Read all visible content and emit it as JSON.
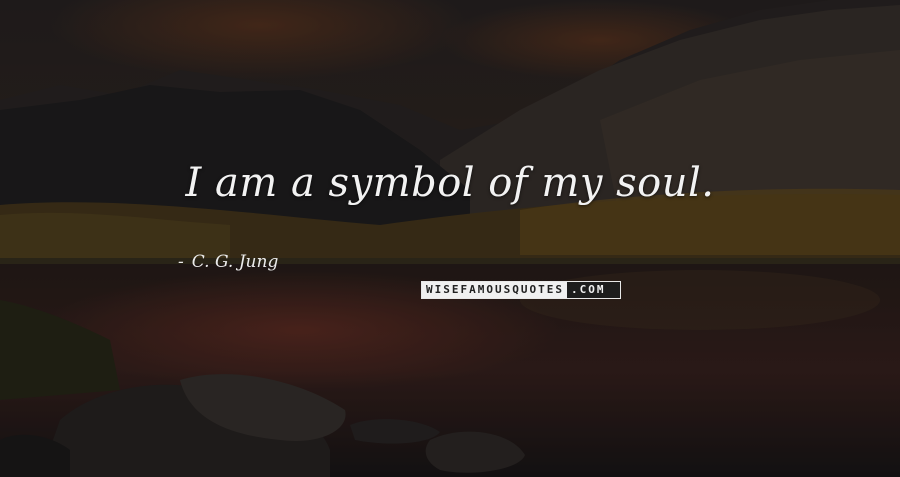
{
  "quote": {
    "text": "I am a symbol of my soul."
  },
  "author": {
    "dash": "-",
    "name": "C. G. Jung"
  },
  "watermark": {
    "part1": "WISEFAMOUSQUOTES",
    "part2": ".COM"
  }
}
